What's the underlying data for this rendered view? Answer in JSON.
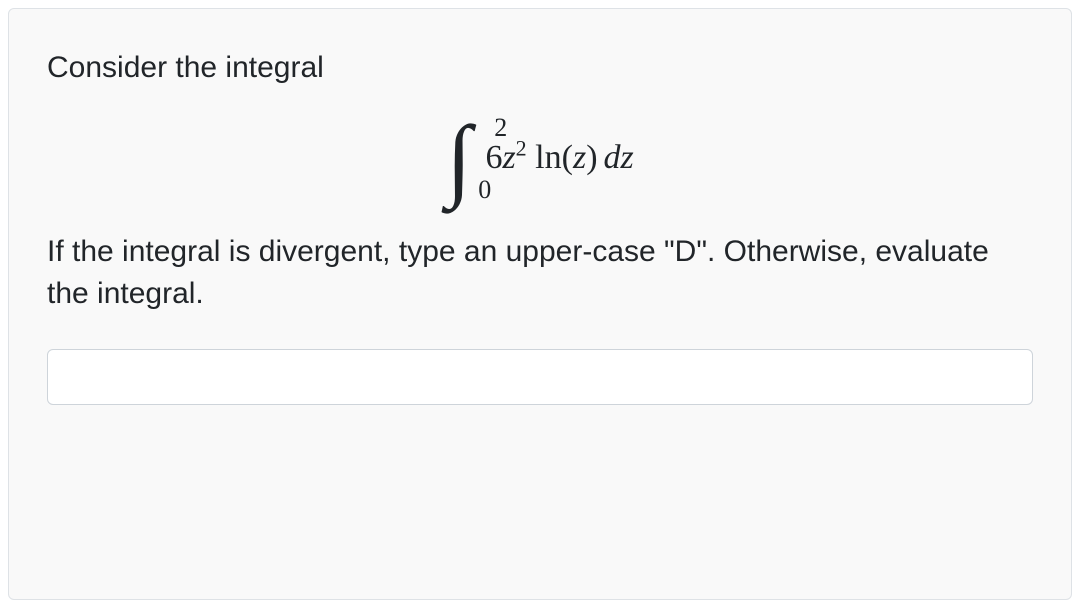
{
  "question": {
    "prompt": "Consider the integral",
    "integral": {
      "upper_limit": "2",
      "lower_limit": "0",
      "coefficient": "6",
      "variable": "z",
      "exponent": "2",
      "func": "ln",
      "diff": "dz"
    },
    "instruction": "If the integral is divergent, type an upper-case \"D\". Otherwise, evaluate the integral."
  },
  "answer": {
    "value": "",
    "placeholder": ""
  }
}
